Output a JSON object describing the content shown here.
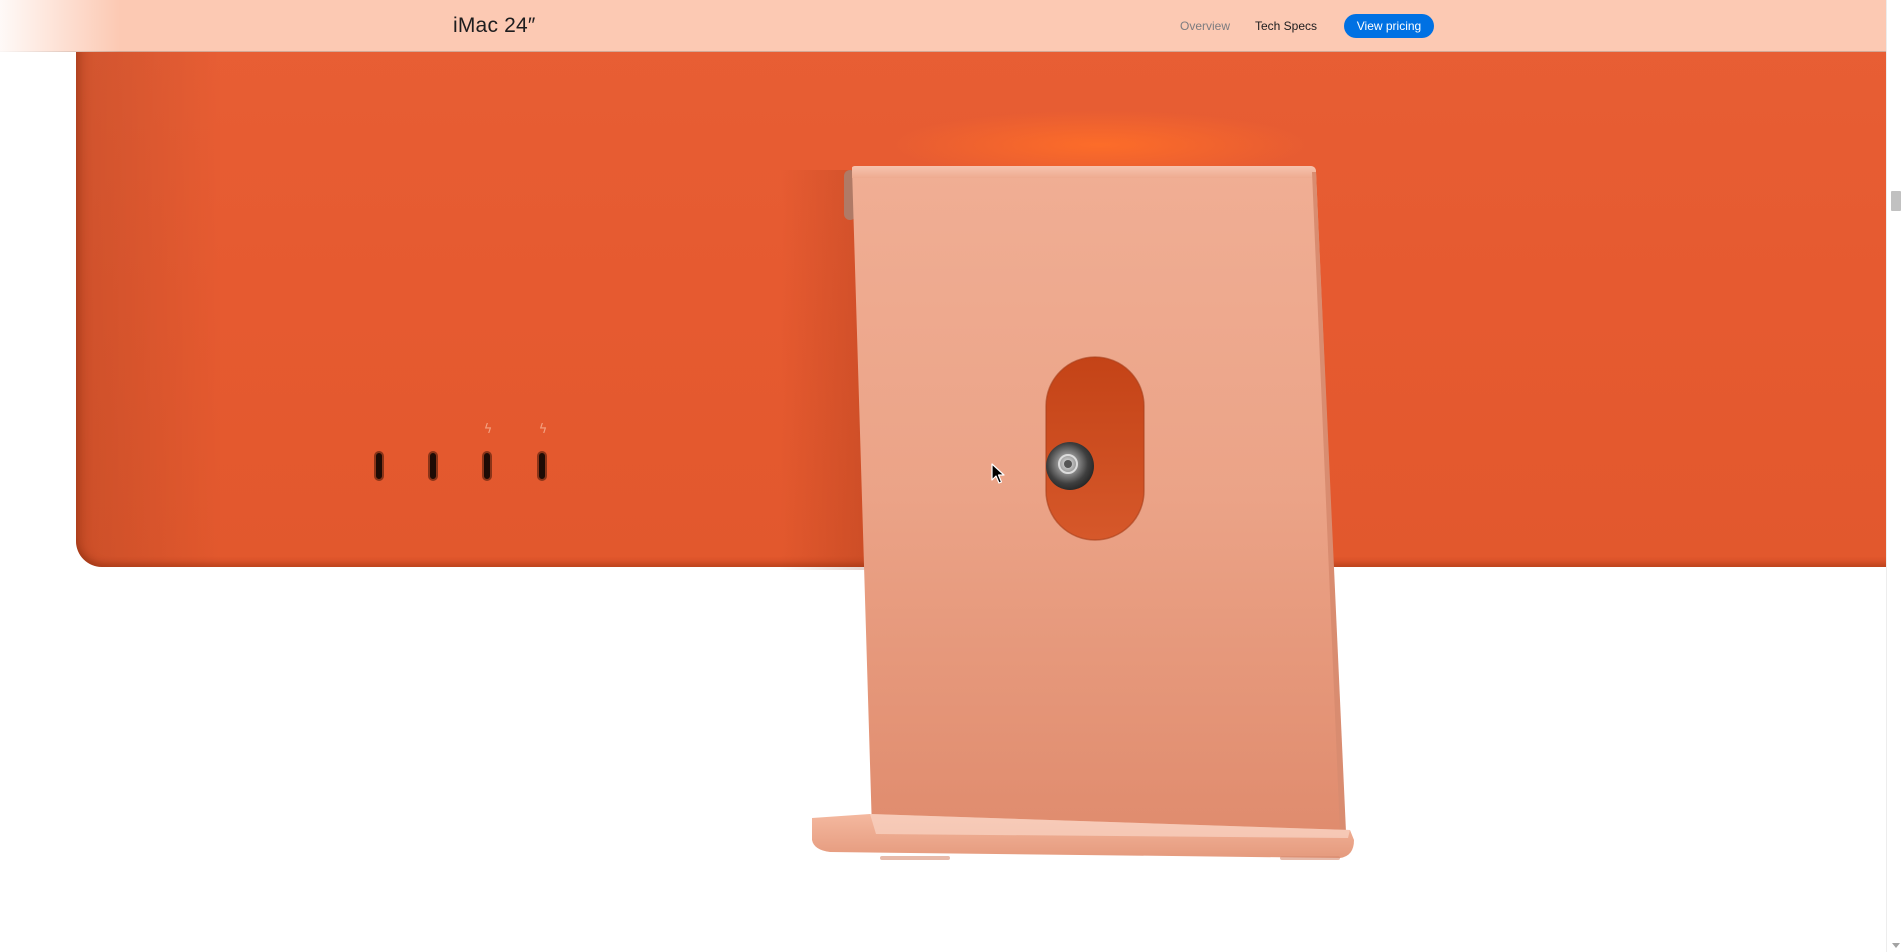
{
  "localnav": {
    "title": "iMac 24″",
    "links": [
      {
        "label": "Overview"
      },
      {
        "label": "Tech Specs"
      }
    ],
    "cta_label": "View pricing"
  },
  "hero": {
    "product_color": "#e65a30",
    "stand_color": "#eda58b",
    "port_count": 4,
    "thunderbolt_ports": 2,
    "icons": {
      "thunderbolt": "thunderbolt-icon",
      "cursor": "mouse-pointer-icon"
    }
  },
  "colors": {
    "nav_background": "#fcc9b3",
    "cta_background": "#0071e3",
    "cta_text": "#ffffff"
  }
}
